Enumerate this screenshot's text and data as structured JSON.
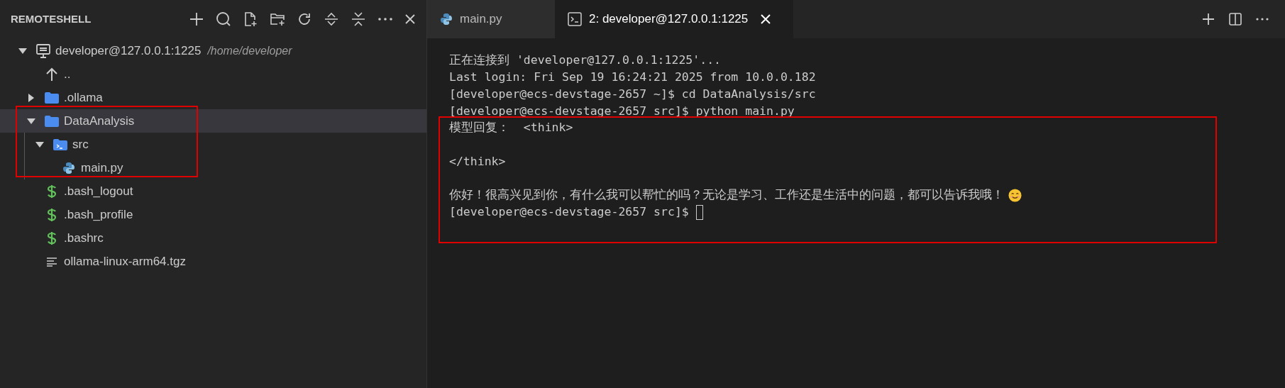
{
  "sidebar": {
    "title": "REMOTESHELL",
    "tree": [
      {
        "kind": "host",
        "label": "developer@127.0.0.1:1225",
        "path": "/home/developer",
        "expanded": true,
        "selected": false,
        "children": [
          {
            "kind": "up",
            "label": "..",
            "selected": false
          },
          {
            "kind": "folder",
            "label": ".ollama",
            "expanded": false,
            "selected": false
          },
          {
            "kind": "folder",
            "label": "DataAnalysis",
            "expanded": true,
            "selected": true,
            "children": [
              {
                "kind": "terminal-folder",
                "label": "src",
                "expanded": true,
                "selected": false,
                "children": [
                  {
                    "kind": "python",
                    "label": "main.py",
                    "selected": false
                  }
                ]
              }
            ]
          },
          {
            "kind": "shell",
            "label": ".bash_logout",
            "selected": false
          },
          {
            "kind": "shell",
            "label": ".bash_profile",
            "selected": false
          },
          {
            "kind": "shell",
            "label": ".bashrc",
            "selected": false
          },
          {
            "kind": "text",
            "label": "ollama-linux-arm64.tgz",
            "selected": false
          }
        ]
      }
    ]
  },
  "tabs": [
    {
      "kind": "python",
      "label": "main.py",
      "selected": false
    },
    {
      "kind": "terminal",
      "label": "2: developer@127.0.0.1:1225",
      "selected": true
    }
  ],
  "terminal": {
    "lines": [
      {
        "kind": "text",
        "text": "正在连接到 'developer@127.0.0.1:1225'..."
      },
      {
        "kind": "text",
        "text": "Last login: Fri Sep 19 16:24:21 2025 from 10.0.0.182"
      },
      {
        "kind": "text",
        "text": "[developer@ecs-devstage-2657 ~]$ cd DataAnalysis/src"
      },
      {
        "kind": "text",
        "text": "[developer@ecs-devstage-2657 src]$ python main.py"
      },
      {
        "kind": "text",
        "text": "模型回复：  <think>"
      },
      {
        "kind": "blank"
      },
      {
        "kind": "text",
        "text": "</think>"
      },
      {
        "kind": "blank"
      },
      {
        "kind": "text",
        "text": "你好！很高兴见到你，有什么我可以帮忙的吗？无论是学习、工作还是生活中的问题，都可以告诉我哦！",
        "smiley": true
      },
      {
        "kind": "text",
        "text": "[developer@ecs-devstage-2657 src]$ ",
        "cursor": true
      }
    ]
  }
}
